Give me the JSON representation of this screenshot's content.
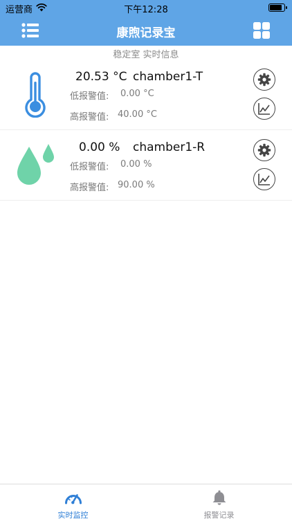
{
  "status_bar": {
    "carrier": "运营商",
    "time": "下午12:28"
  },
  "nav": {
    "title": "康煦记录宝",
    "menu_icon": "list-icon",
    "grid_icon": "grid-icon"
  },
  "subtitle": "稳定室 实时信息",
  "sensors": [
    {
      "icon": "thermometer-icon",
      "value": "20.53 °C",
      "name": "chamber1-T",
      "low_label": "低报警值:",
      "low_value": "0.00 °C",
      "high_label": "高报警值:",
      "high_value": "40.00 °C"
    },
    {
      "icon": "humidity-drops-icon",
      "value": "0.00 %",
      "name": "chamber1-R",
      "low_label": "低报警值:",
      "low_value": "0.00 %",
      "high_label": "高报警值:",
      "high_value": "90.00 %"
    }
  ],
  "tabs": [
    {
      "label": "实时监控",
      "icon": "gauge-icon",
      "active": true
    },
    {
      "label": "报警记录",
      "icon": "bell-icon",
      "active": false
    }
  ],
  "colors": {
    "nav_bg": "#5fa5e6",
    "tab_active": "#2f7fd6",
    "tab_inactive": "#8e8e93",
    "thermometer": "#3b8ee0",
    "drops": "#6fd3a9"
  }
}
